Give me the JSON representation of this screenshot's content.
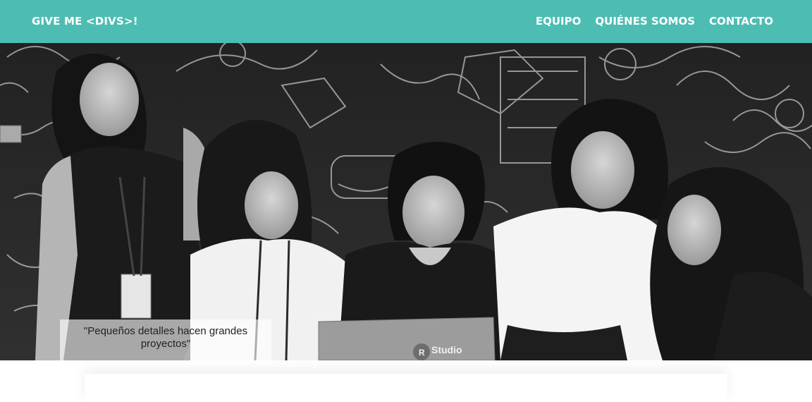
{
  "navbar": {
    "brand": "GIVE ME <DIVS>!",
    "links": [
      {
        "label": "EQUIPO"
      },
      {
        "label": "QUIÉNES SOMOS"
      },
      {
        "label": "CONTACTO"
      }
    ],
    "color": "#4dbdb3"
  },
  "hero": {
    "caption": "\"Pequeños detalles hacen grandes proyectos\"",
    "image_icon": "team-photo-grayscale",
    "laptop_logo": "RStudio"
  }
}
